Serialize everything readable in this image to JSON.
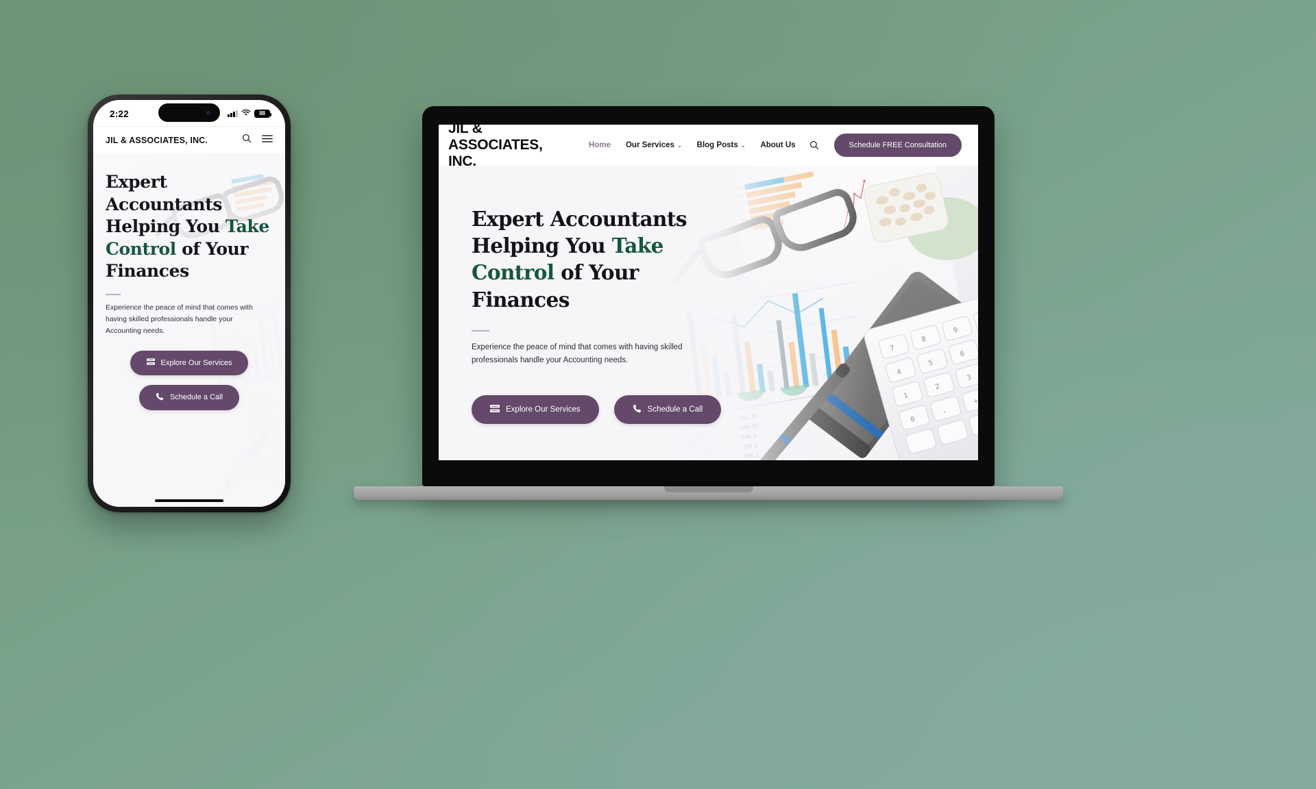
{
  "background": {
    "color_top_left": "#6f9579",
    "color_bottom_right": "#83a99d"
  },
  "theme": {
    "purple": "#64496b",
    "green_accent": "#15573a",
    "nav_active": "#8b7a9e",
    "hero_bg": "#f6f5f8"
  },
  "phone": {
    "status_bar": {
      "time": "2:22",
      "signal_icon": "cellular-signal-icon",
      "wifi_icon": "wifi-icon",
      "battery_level": "88",
      "dynamic_island": "dynamic-island"
    },
    "nav": {
      "brand": "JIL & ASSOCIATES, INC.",
      "search_icon": "search-icon",
      "menu_icon": "hamburger-menu-icon"
    },
    "hero": {
      "heading_part1": "Expert Accountants Helping You ",
      "heading_accent": "Take Control",
      "heading_part2": " of Your Finances",
      "subtext": "Experience the peace of mind that comes with having skilled professionals handle your Accounting needs.",
      "buttons": [
        {
          "label": "Explore Our Services",
          "icon": "list-stack-icon"
        },
        {
          "label": "Schedule a Call",
          "icon": "phone-icon"
        }
      ]
    },
    "home_indicator": "home-indicator"
  },
  "laptop": {
    "nav": {
      "brand": "JIL & ASSOCIATES, INC.",
      "links": [
        {
          "label": "Home",
          "active": true,
          "has_caret": false
        },
        {
          "label": "Our Services",
          "active": false,
          "has_caret": true
        },
        {
          "label": "Blog Posts",
          "active": false,
          "has_caret": true
        },
        {
          "label": "About Us",
          "active": false,
          "has_caret": false
        }
      ],
      "caret_glyph": "⌄",
      "search_icon": "search-icon",
      "cta_label": "Schedule FREE Consultation"
    },
    "hero": {
      "heading_part1": "Expert Accountants Helping You ",
      "heading_accent": "Take Control",
      "heading_part2": " of Your Finances",
      "subtext": "Experience the peace of mind that comes with having skilled professionals handle your Accounting needs.",
      "buttons": [
        {
          "label": "Explore Our Services",
          "icon": "list-stack-icon"
        },
        {
          "label": "Schedule a Call",
          "icon": "phone-icon"
        }
      ]
    }
  },
  "hero_photo": {
    "description": "accounting-desk-photo",
    "elements": [
      "eyeglasses",
      "bar-chart-report",
      "calculator",
      "pen",
      "plant",
      "spreadsheet-numbers"
    ]
  }
}
